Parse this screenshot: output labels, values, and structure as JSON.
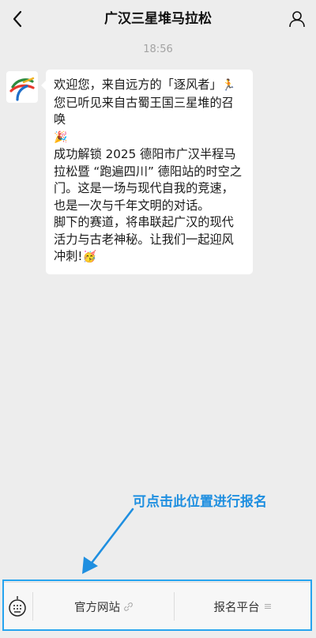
{
  "header": {
    "title": "广汉三星堆马拉松",
    "back_icon": "chevron-left-icon",
    "profile_icon": "person-icon"
  },
  "chat": {
    "timestamp": "18:56",
    "message": {
      "line1": "欢迎您，来自远方的「逐风者」",
      "line2": "您已听见来自古蜀王国三星堆的召唤",
      "line3": "成功解锁 2025 德阳市广汉半程马拉松暨 “跑遍四川” 德阳站的时空之门。这是一场与现代自我的竞速，也是一次与千年文明的对话。",
      "line4": "脚下的赛道，将串联起广汉的现代活力与古老神秘。让我们一起迎风冲刺!",
      "emoji_runner": "🏃",
      "emoji_party": "🎉",
      "emoji_face": "🥳"
    }
  },
  "annotation": {
    "text": "可点击此位置进行报名",
    "color": "#1f8fe0"
  },
  "bottom_menu": {
    "keyboard_icon": "keyboard-icon",
    "items": [
      {
        "label": "官方网站",
        "icon": "link-icon"
      },
      {
        "label": "报名平台",
        "icon": "menu-lines-icon"
      }
    ]
  },
  "colors": {
    "background": "#ededed",
    "highlight_border": "#26a4ef"
  }
}
